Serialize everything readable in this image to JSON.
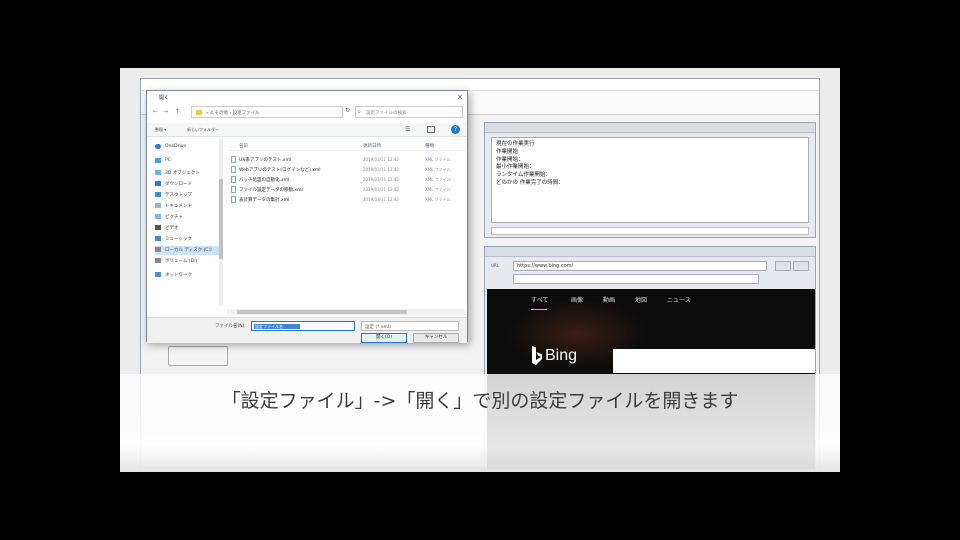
{
  "subtitle": "「設定ファイル」->「開く」で別の設定ファイルを開きます",
  "colors": {
    "accent": "#1e78d7",
    "bing_bg": "#0d0c0c"
  },
  "app": {
    "title": ""
  },
  "log_panel": {
    "title": "",
    "lines": [
      "現在の作業実行",
      "作業開始",
      "作業開始：",
      "最小作業開始：",
      "ランタイム作業開始：",
      "どのかの 作業完了の時間："
    ]
  },
  "browser_panel": {
    "title": "",
    "url_label": "URL",
    "url": "https://www.bing.com/",
    "bing": {
      "tabs": [
        "すべて",
        "画像",
        "動画",
        "地図",
        "ニュース"
      ],
      "logo": "Bing"
    }
  },
  "file_dialog": {
    "title": "開く",
    "path": "« 4.その他 › 設定ファイル",
    "search_placeholder": "設定ファイルの検索",
    "organize": "整理 ▾",
    "new_folder": "新しいフォルダー",
    "nav_items": [
      {
        "label": "OneDrive",
        "icon": "cloud-icon"
      },
      {
        "label": "PC",
        "icon": "pc-icon"
      },
      {
        "label": "3D オブジェクト",
        "icon": "cube-icon"
      },
      {
        "label": "ダウンロード",
        "icon": "download-icon"
      },
      {
        "label": "デスクトップ",
        "icon": "desktop-icon"
      },
      {
        "label": "ドキュメント",
        "icon": "document-icon"
      },
      {
        "label": "ピクチャ",
        "icon": "picture-icon"
      },
      {
        "label": "ビデオ",
        "icon": "video-icon"
      },
      {
        "label": "ミュージック",
        "icon": "music-icon"
      },
      {
        "label": "ローカル ディスク (C:)",
        "icon": "disk-icon"
      },
      {
        "label": "ボリューム (D:)",
        "icon": "disk-icon"
      },
      {
        "label": "ネットワーク",
        "icon": "network-icon"
      }
    ],
    "columns": [
      "名前",
      "更新日時",
      "種類"
    ],
    "files": [
      {
        "name": "UX系アプリのテスト.xml",
        "date": "2019/03/11 12:42",
        "type": "XML ファイル"
      },
      {
        "name": "Webアプリのテスト(ログインなど).xml",
        "date": "2019/03/11 12:42",
        "type": "XML ファイル"
      },
      {
        "name": "バッチ処理の自動化.xml",
        "date": "2019/03/11 12:42",
        "type": "XML ファイル"
      },
      {
        "name": "ファイル設定データの移動.xml",
        "date": "2019/03/11 12:42",
        "type": "XML ファイル"
      },
      {
        "name": "表計算データの集計.xml",
        "date": "2019/03/11 12:42",
        "type": "XML ファイル"
      }
    ],
    "filename_label": "ファイル名(N):",
    "filename_value": "設定ファイル名",
    "filter": "設定 (*.xml)",
    "open_label": "開く(O)",
    "cancel_label": "キャンセル"
  }
}
